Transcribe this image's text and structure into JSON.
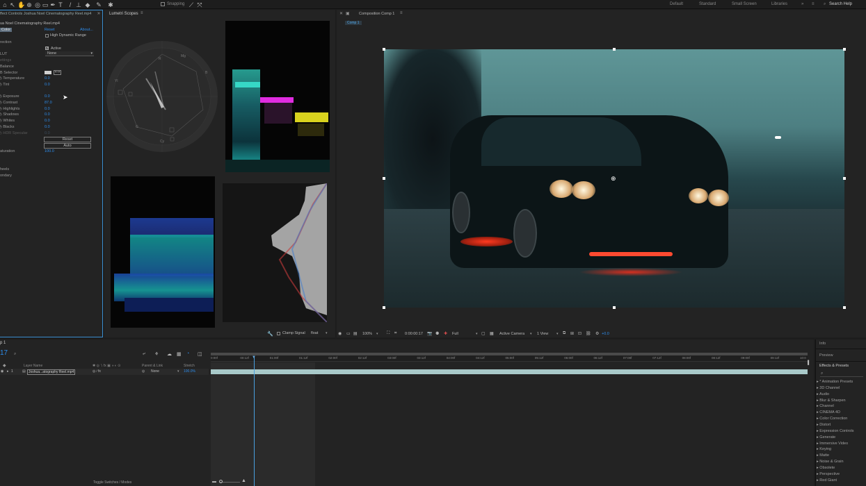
{
  "toolbar": {
    "snapping": "Snapping",
    "workspaces": [
      "Default",
      "Standard",
      "Small Screen",
      "Libraries"
    ],
    "search_help": "Search Help"
  },
  "effect_controls": {
    "title": "ffect Controls Joshua Noel Cinematography Reel.mp4",
    "source": "ua Noel Cinematography Reel.mp4",
    "tab": "Color",
    "reset_label": "Reset",
    "about_label": "About...",
    "hdr_label": "High Dynamic Range",
    "rows": [
      {
        "label": "rection"
      },
      {
        "label": "Active"
      },
      {
        "label": "LUT",
        "value": "None"
      },
      {
        "label": "ettings"
      },
      {
        "label": "Balance"
      },
      {
        "label": "B Selector"
      },
      {
        "label": "Temperature",
        "value": "0.0"
      },
      {
        "label": "Tint",
        "value": "0.0"
      },
      {
        "label": "Exposure",
        "value": "0.0"
      },
      {
        "label": "Contrast",
        "value": "87.0"
      },
      {
        "label": "Highlights",
        "value": "0.0"
      },
      {
        "label": "Shadows",
        "value": "0.0"
      },
      {
        "label": "Whites",
        "value": "0.0"
      },
      {
        "label": "Blacks",
        "value": "0.0"
      },
      {
        "label": "HDR Specular",
        "value": "0.0"
      },
      {
        "label": "aturation",
        "value": "100.0"
      },
      {
        "label": "heels"
      },
      {
        "label": "ondary"
      }
    ],
    "reset_btn": "Reset",
    "auto_btn": "Auto"
  },
  "lumetri": {
    "title": "Lumetri Scopes",
    "bit_label": "8 Bit",
    "clamp_signal": "Clamp Signal",
    "float_value": "float",
    "vectorscope_labels": [
      "R",
      "Mg",
      "B",
      "Cy",
      "G",
      "Yl"
    ],
    "parade_scale": [
      "100",
      "90",
      "80",
      "70",
      "60",
      "50",
      "40",
      "30",
      "20",
      "10",
      "0"
    ],
    "parade_right_scale": [
      "1.0",
      "0.9",
      "0.8",
      "0.7",
      "0.6",
      "0.5",
      "0.4",
      "0.3",
      "0.2",
      "0.1",
      "0.0"
    ]
  },
  "composition": {
    "title": "Composition Comp 1",
    "tab": "Comp 1",
    "zoom": "100%",
    "timecode": "0:00:00:17",
    "resolution": "Full",
    "camera": "Active Camera",
    "views": "1 View",
    "exposure": "+0.0"
  },
  "timeline": {
    "tab": "p 1",
    "timecode": "17",
    "columns": {
      "layer_name": "Layer Name",
      "parent": "Parent & Link",
      "stretch": "Stretch"
    },
    "layer": {
      "num": "1",
      "name": "Joshua...atography Reel.mp4",
      "parent": "None",
      "stretch": "100.0%"
    },
    "ruler": [
      "0:00f",
      "00:12f",
      "01:00f",
      "01:12f",
      "02:00f",
      "02:12f",
      "03:00f",
      "03:12f",
      "04:00f",
      "04:12f",
      "05:00f",
      "05:12f",
      "06:00f",
      "06:12f",
      "07:00f",
      "07:12f",
      "08:00f",
      "08:12f",
      "09:00f",
      "09:12f",
      "10:0"
    ],
    "toggle": "Toggle Switches / Modes"
  },
  "right_panel": {
    "info": "Info",
    "preview": "Preview",
    "effects_presets": "Effects & Presets",
    "items": [
      "* Animation Presets",
      "3D Channel",
      "Audio",
      "Blur & Sharpen",
      "Channel",
      "CINEMA 4D",
      "Color Correction",
      "Distort",
      "Expression Controls",
      "Generate",
      "Immersive Video",
      "Keying",
      "Matte",
      "Noise & Grain",
      "Obsolete",
      "Perspective",
      "Red Giant"
    ]
  },
  "colors": {
    "accent": "#2d8ceb",
    "panel": "#232323",
    "bg": "#1d1d1d",
    "cyan_track": "#a8c9c9"
  }
}
